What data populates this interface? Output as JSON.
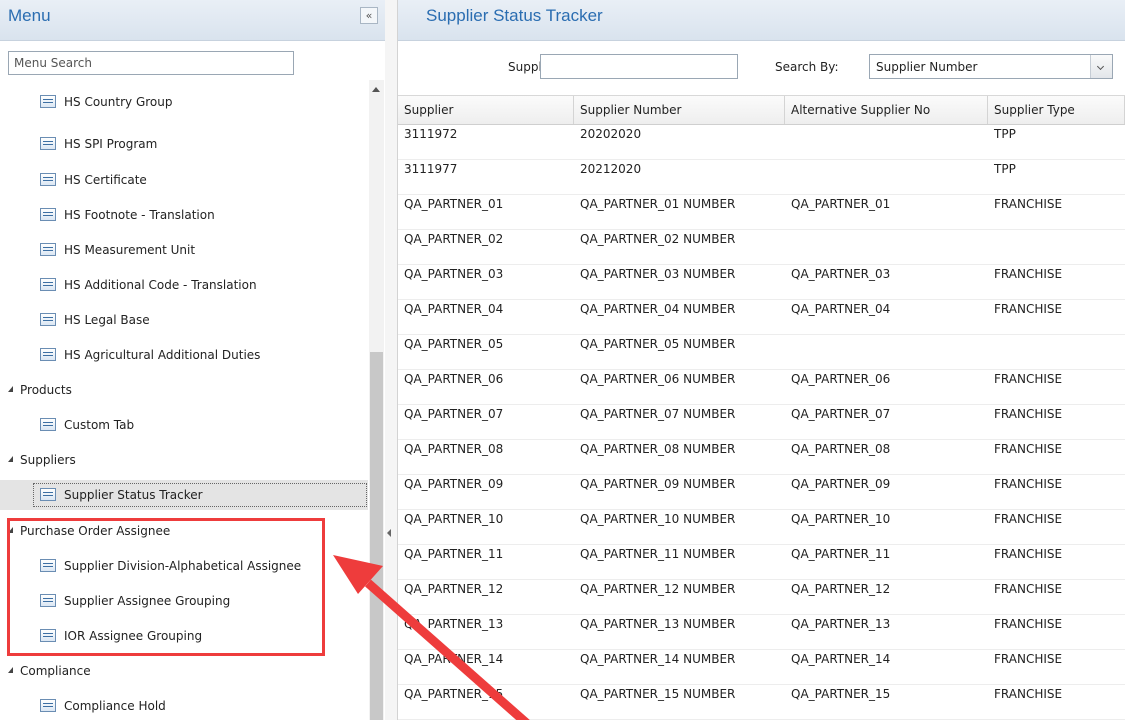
{
  "menu": {
    "title": "Menu",
    "collapse_icon": "double-chevron-left",
    "search_placeholder": "Menu Search",
    "items": [
      {
        "label": "HS Country Group",
        "type": "item"
      },
      {
        "label": "HS SPI Program",
        "type": "item"
      },
      {
        "label": "HS Certificate",
        "type": "item"
      },
      {
        "label": "HS Footnote - Translation",
        "type": "item"
      },
      {
        "label": "HS Measurement Unit",
        "type": "item"
      },
      {
        "label": "HS Additional Code - Translation",
        "type": "item"
      },
      {
        "label": "HS Legal Base",
        "type": "item"
      },
      {
        "label": "HS Agricultural Additional Duties",
        "type": "item"
      },
      {
        "label": "Products",
        "type": "group"
      },
      {
        "label": "Custom Tab",
        "type": "item"
      },
      {
        "label": "Suppliers",
        "type": "group"
      },
      {
        "label": "Supplier Status Tracker",
        "type": "item",
        "selected": true
      },
      {
        "label": "Purchase Order Assignee",
        "type": "group"
      },
      {
        "label": "Supplier Division-Alphabetical Assignee",
        "type": "item"
      },
      {
        "label": "Supplier Assignee Grouping",
        "type": "item"
      },
      {
        "label": "IOR Assignee Grouping",
        "type": "item"
      },
      {
        "label": "Compliance",
        "type": "group"
      },
      {
        "label": "Compliance Hold",
        "type": "item"
      }
    ]
  },
  "content": {
    "title": "Supplier Status Tracker",
    "search": {
      "supplier_label": "Supplier:",
      "supplier_value": "",
      "search_by_label": "Search By:",
      "search_by_value": "Supplier Number"
    },
    "grid": {
      "columns": [
        "Supplier",
        "Supplier Number",
        "Alternative Supplier No",
        "Supplier Type"
      ],
      "rows": [
        [
          "3111972",
          "20202020",
          "",
          "TPP"
        ],
        [
          "3111977",
          "20212020",
          "",
          "TPP"
        ],
        [
          "QA_PARTNER_01",
          "QA_PARTNER_01 NUMBER",
          "QA_PARTNER_01",
          "FRANCHISE"
        ],
        [
          "QA_PARTNER_02",
          "QA_PARTNER_02 NUMBER",
          "",
          ""
        ],
        [
          "QA_PARTNER_03",
          "QA_PARTNER_03 NUMBER",
          "QA_PARTNER_03",
          "FRANCHISE"
        ],
        [
          "QA_PARTNER_04",
          "QA_PARTNER_04 NUMBER",
          "QA_PARTNER_04",
          "FRANCHISE"
        ],
        [
          "QA_PARTNER_05",
          "QA_PARTNER_05 NUMBER",
          "",
          ""
        ],
        [
          "QA_PARTNER_06",
          "QA_PARTNER_06 NUMBER",
          "QA_PARTNER_06",
          "FRANCHISE"
        ],
        [
          "QA_PARTNER_07",
          "QA_PARTNER_07 NUMBER",
          "QA_PARTNER_07",
          "FRANCHISE"
        ],
        [
          "QA_PARTNER_08",
          "QA_PARTNER_08 NUMBER",
          "QA_PARTNER_08",
          "FRANCHISE"
        ],
        [
          "QA_PARTNER_09",
          "QA_PARTNER_09 NUMBER",
          "QA_PARTNER_09",
          "FRANCHISE"
        ],
        [
          "QA_PARTNER_10",
          "QA_PARTNER_10 NUMBER",
          "QA_PARTNER_10",
          "FRANCHISE"
        ],
        [
          "QA_PARTNER_11",
          "QA_PARTNER_11 NUMBER",
          "QA_PARTNER_11",
          "FRANCHISE"
        ],
        [
          "QA_PARTNER_12",
          "QA_PARTNER_12 NUMBER",
          "QA_PARTNER_12",
          "FRANCHISE"
        ],
        [
          "QA_PARTNER_13",
          "QA_PARTNER_13 NUMBER",
          "QA_PARTNER_13",
          "FRANCHISE"
        ],
        [
          "QA_PARTNER_14",
          "QA_PARTNER_14 NUMBER",
          "QA_PARTNER_14",
          "FRANCHISE"
        ],
        [
          "QA_PARTNER_15",
          "QA_PARTNER_15 NUMBER",
          "QA_PARTNER_15",
          "FRANCHISE"
        ]
      ]
    }
  },
  "annotation": {
    "highlight_color": "#ee3c3c",
    "arrow_color": "#ee3c3c"
  },
  "colors": {
    "header_title": "#2a6db1",
    "header_bg": "#dfe7f0",
    "selected_row_bg": "#e4e4e4"
  }
}
